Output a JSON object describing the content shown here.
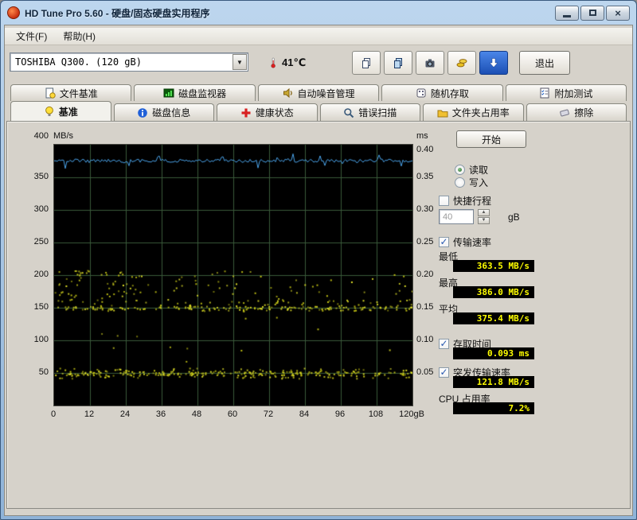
{
  "window": {
    "title": "HD Tune Pro 5.60 - 硬盘/固态硬盘实用程序"
  },
  "menu": {
    "file": "文件(F)",
    "help": "帮助(H)"
  },
  "toolbar": {
    "drive_selector": "TOSHIBA Q300. (120 gB)",
    "temperature": "41℃",
    "exit_label": "退出"
  },
  "tabs_top": {
    "file_benchmark": "文件基准",
    "disk_monitor": "磁盘监视器",
    "aam": "自动噪音管理",
    "random_access": "随机存取",
    "extra_tests": "附加测试"
  },
  "tabs_bottom": {
    "benchmark": "基准",
    "disk_info": "磁盘信息",
    "health": "健康状态",
    "error_scan": "错误扫描",
    "folder_usage": "文件夹占用率",
    "erase": "擦除"
  },
  "panel": {
    "start": "开始",
    "read": "读取",
    "write": "写入",
    "short_stroke": "快捷行程",
    "short_stroke_value": "40",
    "short_stroke_unit": "gB",
    "transfer_rate": "传输速率",
    "min_label": "最低",
    "min_value": "363.5 MB/s",
    "max_label": "最高",
    "max_value": "386.0 MB/s",
    "avg_label": "平均",
    "avg_value": "375.4 MB/s",
    "access_time": "存取时间",
    "access_time_value": "0.093 ms",
    "burst_rate": "突发传输速率",
    "burst_rate_value": "121.8 MB/s",
    "cpu_usage": "CPU 占用率",
    "cpu_usage_value": "7.2%"
  },
  "chart_data": {
    "type": "line",
    "title": "HD Tune benchmark transfer rate and access time",
    "left_axis": {
      "unit": "MB/s",
      "ticks": [
        "400",
        "350",
        "300",
        "250",
        "200",
        "150",
        "100",
        "50"
      ],
      "range": [
        0,
        400
      ]
    },
    "right_axis": {
      "unit": "ms",
      "ticks": [
        "0.40",
        "0.35",
        "0.30",
        "0.25",
        "0.20",
        "0.15",
        "0.10",
        "0.05"
      ],
      "range": [
        0,
        0.4
      ]
    },
    "x_ticks": [
      "0",
      "12",
      "24",
      "36",
      "48",
      "60",
      "72",
      "84",
      "96",
      "108",
      "120gB"
    ],
    "x_range_gb": [
      0,
      120
    ],
    "grid_on": true,
    "grid_color": "#3a5a3a",
    "series": [
      {
        "name": "transfer-rate",
        "type": "line",
        "color": "#4aa2e8",
        "unit": "MB/s",
        "min": 363.5,
        "max": 386.0,
        "avg": 375.4
      },
      {
        "name": "access-time",
        "type": "scatter",
        "color": "#d2d21e",
        "unit": "ms",
        "measured": 0.093,
        "bands_ms": [
          [
            0.042,
            0.058
          ],
          [
            0.145,
            0.162
          ],
          [
            0.16,
            0.21
          ]
        ]
      }
    ]
  }
}
